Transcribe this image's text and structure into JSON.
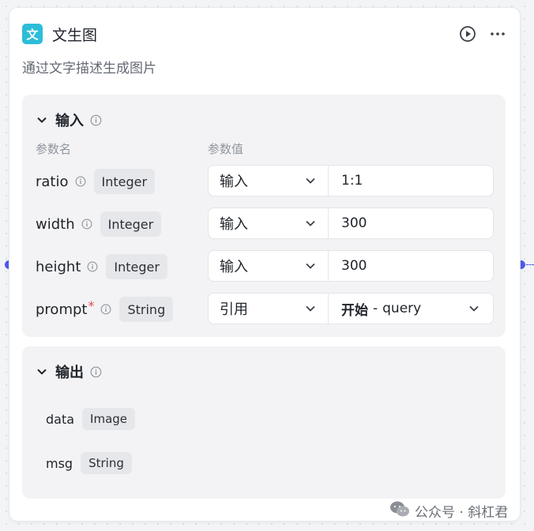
{
  "node": {
    "icon_glyph": "文",
    "title": "文生图",
    "description": "通过文字描述生成图片",
    "icons": {
      "run": "play-circle-icon",
      "more": "more-horizontal-icon"
    }
  },
  "input_section": {
    "title": "输入",
    "col_name": "参数名",
    "col_value": "参数值",
    "params": [
      {
        "name": "ratio",
        "type": "Integer",
        "required": false,
        "source": "输入",
        "value": "1:1"
      },
      {
        "name": "width",
        "type": "Integer",
        "required": false,
        "source": "输入",
        "value": "300"
      },
      {
        "name": "height",
        "type": "Integer",
        "required": false,
        "source": "输入",
        "value": "300"
      },
      {
        "name": "prompt",
        "type": "String",
        "required": true,
        "required_mark": "*",
        "source": "引用",
        "ref_node": "开始",
        "ref_sep": "-",
        "ref_field": "query"
      }
    ]
  },
  "output_section": {
    "title": "输出",
    "fields": [
      {
        "name": "data",
        "type": "Image"
      },
      {
        "name": "msg",
        "type": "String"
      }
    ]
  },
  "watermark": {
    "text": "公众号 · 斜杠君",
    "icon": "wechat-icon"
  },
  "colors": {
    "accent": "#4e5ae8",
    "app_icon_bg": "#2dbdd8",
    "required": "#e5484d"
  }
}
